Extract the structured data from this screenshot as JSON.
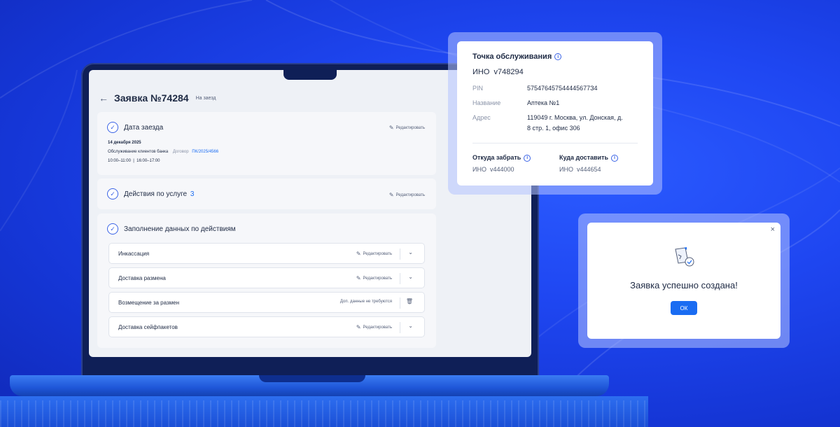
{
  "request": {
    "title": "Заявка №74284",
    "tag": "На заезд",
    "back_icon": "←"
  },
  "cards": {
    "arrival": {
      "title": "Дата заезда",
      "edit_label": "Редактировать",
      "date": "14 декабря 2025",
      "service": "Обслуживание клиентов банка",
      "contract_label": "Договор",
      "contract_value": "ПК/2025/4566",
      "times": "10:00–11:00  |  16:00–17:00"
    },
    "actions": {
      "title": "Действия по услуге",
      "count": "3",
      "edit_label": "Редактировать"
    },
    "filling": {
      "title": "Заполнение данных по действиям",
      "rows": [
        {
          "title": "Инкассация",
          "right": "Редактировать"
        },
        {
          "title": "Доставка размена",
          "right": "Редактировать"
        },
        {
          "title": "Возмещение за размен",
          "right": "Доп. данные не требуются"
        },
        {
          "title": "Доставка сейфпакетов",
          "right": "Редактировать"
        }
      ]
    }
  },
  "service_point": {
    "title": "Точка обслуживания",
    "ino": "ИНО  v748294",
    "pin_label": "PIN",
    "pin_value": "575476457544445677З4",
    "name_label": "Название",
    "name_value": "Аптека №1",
    "address_label": "Адрес",
    "address_line1": "119049 г. Москва, ул. Донская, д.",
    "address_line2": "8 стр. 1, офис 306",
    "from_title": "Откуда забрать",
    "from_value": "ИНО  v444000",
    "to_title": "Куда доставить",
    "to_value": "ИНО  v444654"
  },
  "success_dialog": {
    "message": "Заявка успешно создана!",
    "ok_label": "ОК",
    "close_icon": "×"
  },
  "colors": {
    "background": "#1f47f2",
    "accent": "#1a6cf2"
  }
}
